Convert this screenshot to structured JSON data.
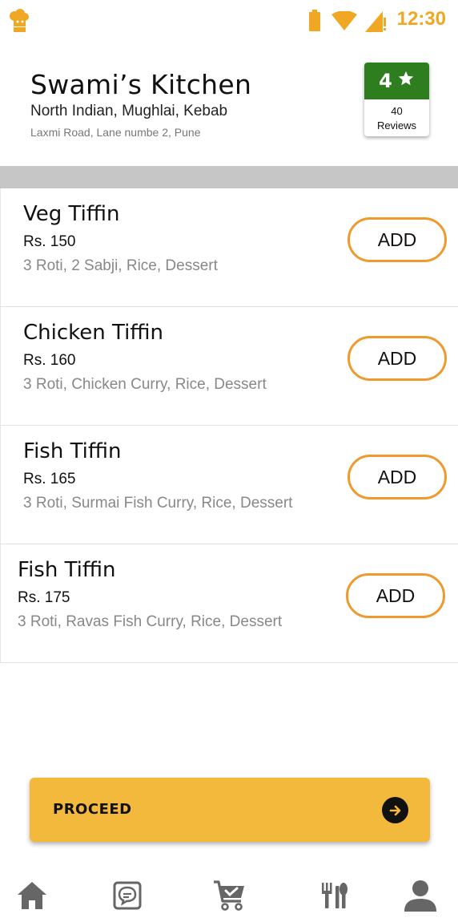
{
  "status_bar": {
    "time": "12:30",
    "icons": [
      "chef-logo-icon",
      "battery-icon",
      "wifi-icon",
      "signal-icon"
    ],
    "accent_color": "#F0A824"
  },
  "restaurant": {
    "name": "Swami’s Kitchen",
    "cuisine": "North Indian, Mughlai, Kebab",
    "address": "Laxmi Road, Lane numbe 2, Pune",
    "rating": "4",
    "review_count": "40",
    "review_label": "Reviews",
    "rating_color": "#2E7D1E"
  },
  "menu": {
    "items": [
      {
        "name": "Veg Tiffin",
        "price": "Rs. 150",
        "description": "3 Roti, 2 Sabji, Rice, Dessert",
        "button": "ADD"
      },
      {
        "name": "Chicken Tiffin",
        "price": "Rs. 160",
        "description": "3 Roti, Chicken Curry, Rice, Dessert",
        "button": "ADD"
      },
      {
        "name": "Fish Tiffin",
        "price": "Rs. 165",
        "description": "3 Roti, Surmai Fish Curry, Rice, Dessert",
        "button": "ADD"
      },
      {
        "name": "Fish Tiffin",
        "price": "Rs. 175",
        "description": "3 Roti, Ravas Fish Curry, Rice, Dessert",
        "button": "ADD"
      }
    ],
    "button_border_color": "#EE9A2E"
  },
  "proceed": {
    "label": "PROCEED",
    "color": "#F3B93D",
    "icon": "arrow-right-circle-icon"
  },
  "bottom_nav": {
    "items": [
      "home-icon",
      "chat-icon",
      "cart-icon",
      "restaurant-icon",
      "profile-icon"
    ],
    "icon_color": "#666666"
  }
}
